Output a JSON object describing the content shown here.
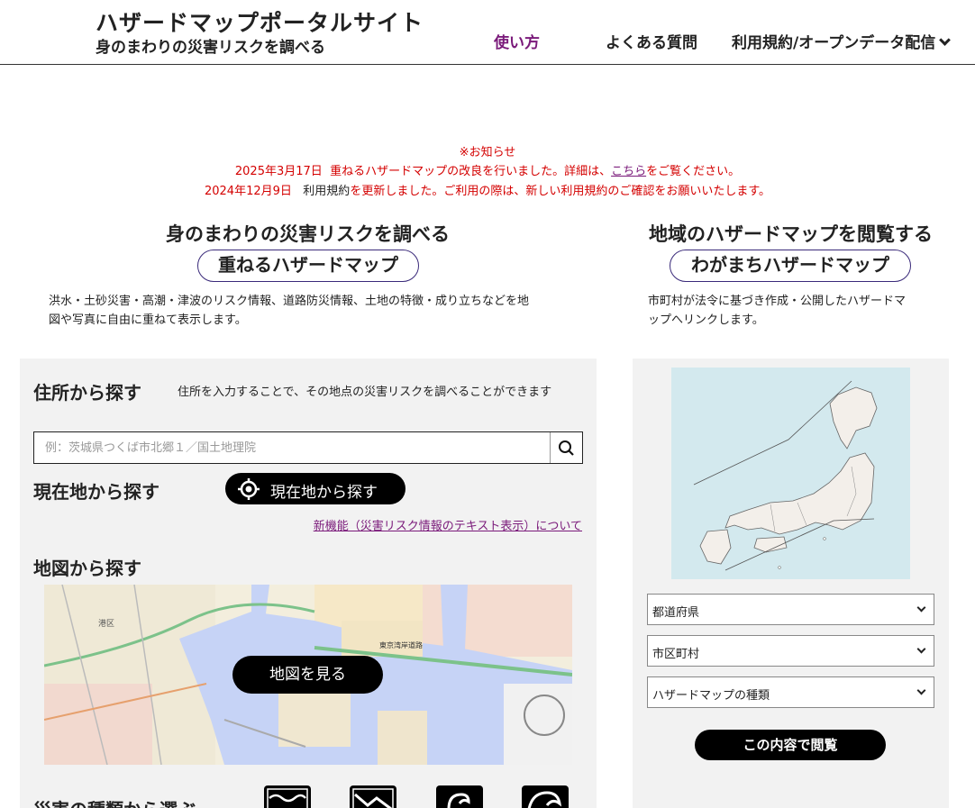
{
  "header": {
    "title": "ハザードマップポータルサイト",
    "subtitle": "身のまわりの災害リスクを調べる",
    "nav": {
      "usage": "使い方",
      "faq": "よくある質問",
      "terms": "利用規約/オープンデータ配信"
    }
  },
  "notice": {
    "heading": "※お知らせ",
    "line1_date": "2025年3月17日",
    "line1_text": "重ねるハザードマップの改良を行いました。詳細は、",
    "line1_link": "こちら",
    "line1_after": "をご覧ください。",
    "line2_date": "2024年12月9日",
    "line2_terms": "利用規約",
    "line2_text": "を更新しました。ご利用の際は、新しい利用規約のご確認をお願いいたします。"
  },
  "left_section": {
    "title": "身のまわりの災害リスクを調べる",
    "app_name": "重ねるハザードマップ",
    "description_line1": "洪水・土砂災害・高潮・津波のリスク情報、道路防災情報、土地の特徴・成り立ちなどを地",
    "description_line2": "図や写真に自由に重ねて表示します。"
  },
  "right_section": {
    "title": "地域のハザードマップを閲覧する",
    "app_name": "わがまちハザードマップ",
    "description_line1": "市町村が法令に基づき作成・公開したハザードマ",
    "description_line2": "ップへリンクします。"
  },
  "search": {
    "address_heading": "住所から探す",
    "address_note": "住所を入力することで、その地点の災害リスクを調べることができます",
    "placeholder": "例：茨城県つくば市北郷１／国土地理院",
    "current_heading": "現在地から探す",
    "current_button": "現在地から探す",
    "new_feature_link": "新機能（災害リスク情報のテキスト表示）について",
    "map_heading": "地図から探す",
    "map_button": "地図を見る",
    "disaster_heading": "災害の種類から選ぶ"
  },
  "map_labels": {
    "ward": "港区",
    "road": "東京湾岸道路"
  },
  "regional": {
    "prefecture_select": "都道府県",
    "city_select": "市区町村",
    "type_select": "ハザードマップの種類",
    "view_button": "この内容で閲覧"
  },
  "colors": {
    "accent_purple": "#7a1a7a",
    "notice_red": "#d40000",
    "panel_gray": "#f2f2f2",
    "button_black": "#000000"
  },
  "icons": [
    "search-icon",
    "location-target-icon",
    "chevron-down-icon",
    "flood-icon",
    "landslide-icon",
    "storm-surge-icon",
    "tsunami-icon"
  ]
}
